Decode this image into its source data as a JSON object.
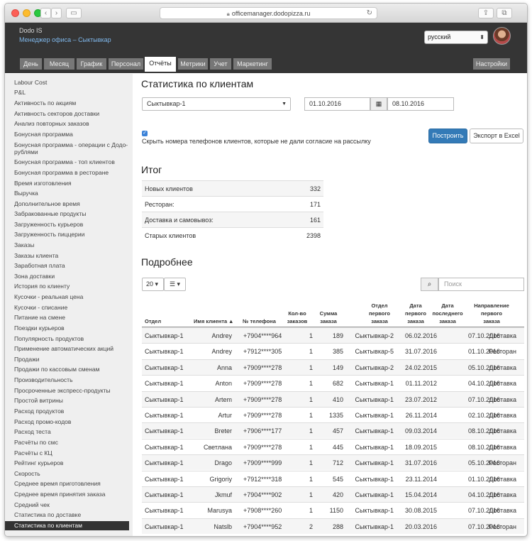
{
  "browser": {
    "url": "officemanager.dodopizza.ru"
  },
  "header": {
    "brand": "Dodo IS",
    "office": "Менеджер офиса – Сыктывкар",
    "language": "русский",
    "tabs": [
      {
        "label": "День"
      },
      {
        "label": "Месяц"
      },
      {
        "label": "График"
      },
      {
        "label": "Персонал"
      },
      {
        "label": "Отчёты"
      },
      {
        "label": "Метрики"
      },
      {
        "label": "Учет"
      },
      {
        "label": "Маркетинг"
      }
    ],
    "settings": "Настройки"
  },
  "sidebar": {
    "items": [
      "Labour Cost",
      "P&L",
      "Активность по акциям",
      "Активность секторов доставки",
      "Анализ повторных заказов",
      "Бонусная программа",
      "Бонусная программа - операции с Додо-",
      "рублями",
      "Бонусная программа - топ клиентов",
      "Бонусная программа в ресторане",
      "Время изготовления",
      "Выручка",
      "Дополнительное время",
      "Забракованные продукты",
      "Загруженность курьеров",
      "Загруженность пиццерии",
      "Заказы",
      "Заказы клиента",
      "Заработная плата",
      "Зона доставки",
      "История по клиенту",
      "Кусочки - реальная цена",
      "Кусочки - списание",
      "Питание на смене",
      "Поездки курьеров",
      "Популярность продуктов",
      "Применение автоматических акций",
      "Продажи",
      "Продажи по кассовым сменам",
      "Производительность",
      "Просроченные экспресс-продукты",
      "Простой витрины",
      "Расход продуктов",
      "Расход промо-кодов",
      "Расход теста",
      "Расчёты по смс",
      "Расчёты с КЦ",
      "Рейтинг курьеров",
      "Скорость",
      "Среднее время приготовления",
      "Среднее время принятия заказа",
      "Средний чек",
      "Статистика по доставке",
      "Статистика по клиентам"
    ]
  },
  "main": {
    "title": "Статистика по клиентам",
    "unit": "Сыктывкар-1",
    "date_from": "01.10.2016",
    "date_to": "08.10.2016",
    "checkbox_label": "Скрыть номера телефонов клиентов, которые не дали согласие на рассылку",
    "build_button": "Построить",
    "export_button": "Экспорт в Excel",
    "summary_title": "Итог",
    "summary": [
      {
        "label": "Новых клиентов",
        "value": "332"
      },
      {
        "label": "Ресторан:",
        "value": "171"
      },
      {
        "label": "Доставка и самовывоз:",
        "value": "161"
      },
      {
        "label": "Старых клиентов",
        "value": "2398"
      }
    ],
    "details_title": "Подробнее",
    "page_size": "20",
    "search_placeholder": "Поиск",
    "columns": [
      {
        "l1": "",
        "l2": "",
        "l3": "Отдел"
      },
      {
        "l1": "",
        "l2": "",
        "l3": "Имя клиента"
      },
      {
        "l1": "",
        "l2": "",
        "l3": "№ телефона"
      },
      {
        "l1": "",
        "l2": "Кол-во",
        "l3": "заказов"
      },
      {
        "l1": "",
        "l2": "Сумма",
        "l3": "заказа"
      },
      {
        "l1": "Отдел",
        "l2": "первого",
        "l3": "заказа"
      },
      {
        "l1": "Дата",
        "l2": "первого",
        "l3": "заказа"
      },
      {
        "l1": "Дата",
        "l2": "последнего",
        "l3": "заказа"
      },
      {
        "l1": "Направление",
        "l2": "первого",
        "l3": "заказа"
      }
    ],
    "rows": [
      [
        "Сыктывкар-1",
        "Andrey",
        "+7904****964",
        "1",
        "189",
        "Сыктывкар-2",
        "06.02.2016",
        "07.10.2016",
        "Доставка"
      ],
      [
        "Сыктывкар-1",
        "Andrey",
        "+7912****305",
        "1",
        "385",
        "Сыктывкар-5",
        "31.07.2016",
        "01.10.2016",
        "Ресторан"
      ],
      [
        "Сыктывкар-1",
        "Anna",
        "+7909****278",
        "1",
        "149",
        "Сыктывкар-2",
        "24.02.2015",
        "05.10.2016",
        "Доставка"
      ],
      [
        "Сыктывкар-1",
        "Anton",
        "+7909****278",
        "1",
        "682",
        "Сыктывкар-1",
        "01.11.2012",
        "04.10.2016",
        "Доставка"
      ],
      [
        "Сыктывкар-1",
        "Artem",
        "+7909****278",
        "1",
        "410",
        "Сыктывкар-1",
        "23.07.2012",
        "07.10.2016",
        "Доставка"
      ],
      [
        "Сыктывкар-1",
        "Artur",
        "+7909****278",
        "1",
        "1335",
        "Сыктывкар-1",
        "26.11.2014",
        "02.10.2016",
        "Доставка"
      ],
      [
        "Сыктывкар-1",
        "Breter",
        "+7906****177",
        "1",
        "457",
        "Сыктывкар-1",
        "09.03.2014",
        "08.10.2016",
        "Доставка"
      ],
      [
        "Сыктывкар-1",
        "Светлана",
        "+7909****278",
        "1",
        "445",
        "Сыктывкар-1",
        "18.09.2015",
        "08.10.2016",
        "Доставка"
      ],
      [
        "Сыктывкар-1",
        "Drago",
        "+7909****999",
        "1",
        "712",
        "Сыктывкар-1",
        "31.07.2016",
        "05.10.2016",
        "Ресторан"
      ],
      [
        "Сыктывкар-1",
        "Grigoriy",
        "+7912****318",
        "1",
        "545",
        "Сыктывкар-1",
        "23.11.2014",
        "01.10.2016",
        "Доставка"
      ],
      [
        "Сыктывкар-1",
        "Jkmuf",
        "+7904****902",
        "1",
        "420",
        "Сыктывкар-1",
        "15.04.2014",
        "04.10.2016",
        "Доставка"
      ],
      [
        "Сыктывкар-1",
        "Marusya",
        "+7908****260",
        "1",
        "1150",
        "Сыктывкар-1",
        "30.08.2015",
        "07.10.2016",
        "Доставка"
      ],
      [
        "Сыктывкар-1",
        "Natslb",
        "+7904****952",
        "2",
        "288",
        "Сыктывкар-1",
        "20.03.2016",
        "07.10.2016",
        "Ресторан"
      ]
    ]
  }
}
